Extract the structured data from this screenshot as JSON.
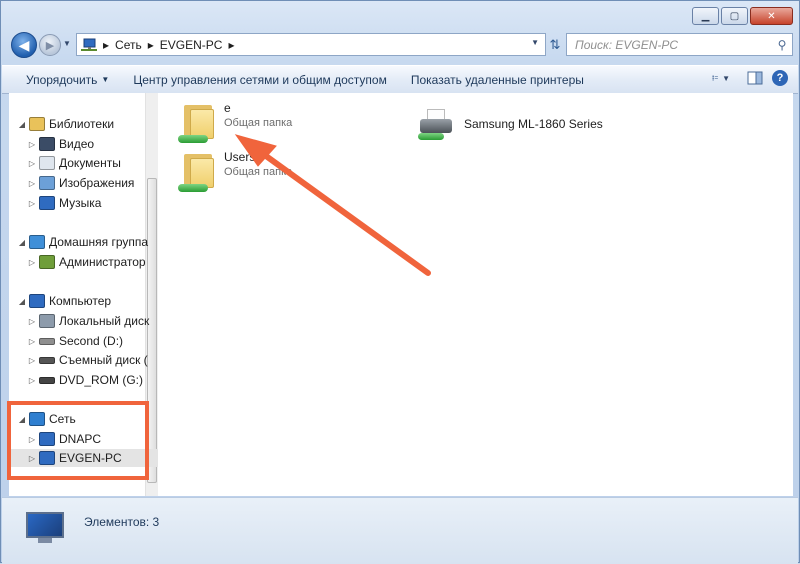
{
  "window": {
    "caption_buttons": {
      "minimize": "▁",
      "maximize": "▢",
      "close": "✕"
    }
  },
  "address_bar": {
    "segments": [
      "Сеть",
      "EVGEN-PC"
    ]
  },
  "search": {
    "placeholder": "Поиск: EVGEN-PC"
  },
  "toolbar": {
    "organize": "Упорядочить",
    "network_center": "Центр управления сетями и общим доступом",
    "show_printers": "Показать удаленные принтеры"
  },
  "nav_tree": [
    {
      "label": "Библиотеки",
      "icon": "libraries-icon",
      "level": 0,
      "expand": "◢"
    },
    {
      "label": "Видео",
      "icon": "video-icon",
      "level": 1,
      "expand": "▷"
    },
    {
      "label": "Документы",
      "icon": "documents-icon",
      "level": 1,
      "expand": "▷"
    },
    {
      "label": "Изображения",
      "icon": "pictures-icon",
      "level": 1,
      "expand": "▷"
    },
    {
      "label": "Музыка",
      "icon": "music-icon",
      "level": 1,
      "expand": "▷"
    },
    {
      "label": "Домашняя группа",
      "icon": "homegroup-icon",
      "level": 0,
      "expand": "◢"
    },
    {
      "label": "Администратор",
      "icon": "user-icon",
      "level": 1,
      "expand": "▷"
    },
    {
      "label": "Компьютер",
      "icon": "computer-icon",
      "level": 0,
      "expand": "◢"
    },
    {
      "label": "Локальный диск",
      "icon": "local-disk-icon",
      "level": 1,
      "expand": "▷"
    },
    {
      "label": "Second (D:)",
      "icon": "drive-icon",
      "level": 1,
      "expand": "▷"
    },
    {
      "label": "Съемный диск (",
      "icon": "removable-disk-icon",
      "level": 1,
      "expand": "▷"
    },
    {
      "label": "DVD_ROM (G:)",
      "icon": "dvd-drive-icon",
      "level": 1,
      "expand": "▷"
    },
    {
      "label": "Сеть",
      "icon": "network-icon",
      "level": 0,
      "expand": "◢"
    },
    {
      "label": "DNAPC",
      "icon": "network-computer-icon",
      "level": 1,
      "expand": "▷"
    },
    {
      "label": "EVGEN-PC",
      "icon": "network-computer-icon",
      "level": 1,
      "expand": "▷",
      "selected": true
    }
  ],
  "content": {
    "items": [
      {
        "name": "e",
        "type": "Общая папка",
        "icon": "shared-folder-icon"
      },
      {
        "name": "Users",
        "type": "Общая папка",
        "icon": "shared-folder-icon"
      },
      {
        "name": "Samsung ML-1860 Series",
        "type": "",
        "icon": "printer-icon"
      }
    ]
  },
  "status_bar": {
    "text": "Элементов: 3"
  },
  "annotation": {
    "color": "#f0643c"
  }
}
